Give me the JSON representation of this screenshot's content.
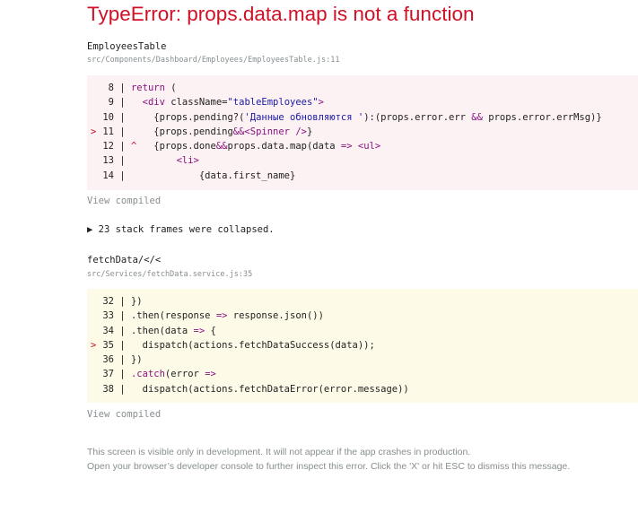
{
  "error": {
    "title": "TypeError: props.data.map is not a function"
  },
  "frames": [
    {
      "fn": "EmployeesTable",
      "file": "src/Components/Dashboard/Employees/EmployeesTable.js:11",
      "view_compiled": "View compiled",
      "lines": [
        {
          "num": "8",
          "text": "return ("
        },
        {
          "num": "9",
          "text": "  <div className=\"tableEmployees\">"
        },
        {
          "num": "10",
          "text": "    {props.pending?('Данные обновляются '):(props.error.err && props.error.errMsg)}"
        },
        {
          "num": "11",
          "text": "    {props.pending&&<Spinner />}"
        },
        {
          "num": "12",
          "text": "    {props.done&&props.data.map(data => <ul>"
        },
        {
          "num": "13",
          "text": "        <li>"
        },
        {
          "num": "14",
          "text": "            {data.first_name}"
        }
      ]
    },
    {
      "fn": "fetchData/</<",
      "file": "src/Services/fetchData.service.js:35",
      "view_compiled": "View compiled",
      "lines": [
        {
          "num": "32",
          "text": "})"
        },
        {
          "num": "33",
          "text": ".then(response => response.json())"
        },
        {
          "num": "34",
          "text": ".then(data => {"
        },
        {
          "num": "35",
          "text": "  dispatch(actions.fetchDataSuccess(data));"
        },
        {
          "num": "36",
          "text": "})"
        },
        {
          "num": "37",
          "text": ".catch(error =>"
        },
        {
          "num": "38",
          "text": "  dispatch(actions.fetchDataError(error.message))"
        }
      ]
    }
  ],
  "collapsed": {
    "arrow": "▶",
    "text": "23 stack frames were collapsed."
  },
  "footer": {
    "line1": "This screen is visible only in development. It will not appear if the app crashes in production.",
    "line2": "Open your browser’s developer console to further inspect this error.  Click the 'X' or hit ESC to dismiss this message."
  },
  "markers": {
    "current_line": ">",
    "caret": "^",
    "separator": "|"
  },
  "colors": {
    "error_red": "#ce1126",
    "error_bg": "#fcf1f3",
    "warn_bg": "#fdfae8",
    "muted": "#878e91"
  }
}
